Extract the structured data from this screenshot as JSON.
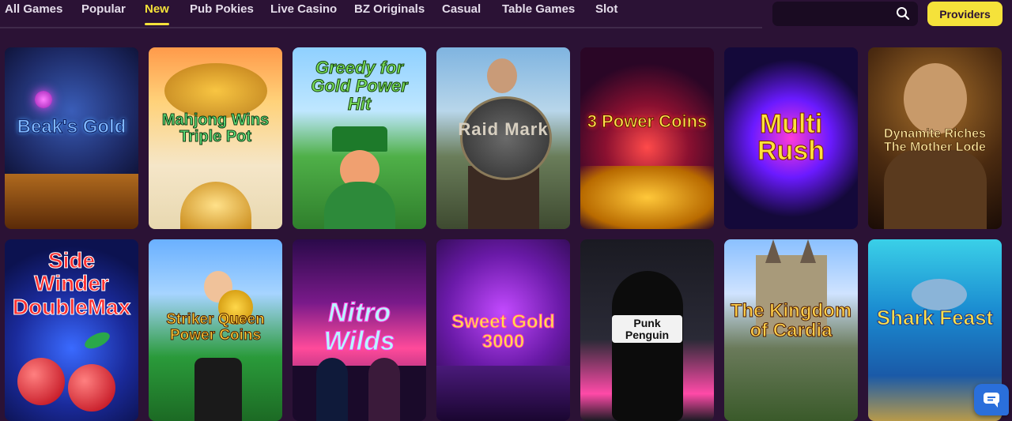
{
  "nav": {
    "tabs": [
      {
        "label": "All Games",
        "active": false
      },
      {
        "label": "Popular",
        "active": false
      },
      {
        "label": "New",
        "active": true
      },
      {
        "label": "Pub Pokies",
        "active": false
      },
      {
        "label": "Live Casino",
        "active": false
      },
      {
        "label": "BZ Originals",
        "active": false
      },
      {
        "label": "Casual",
        "active": false
      },
      {
        "label": "Table Games",
        "active": false
      },
      {
        "label": "Slot",
        "active": false
      }
    ]
  },
  "search": {
    "placeholder": "",
    "icon": "search-icon"
  },
  "providers_button": {
    "label": "Providers"
  },
  "colors": {
    "accent": "#f5e23a",
    "background": "#2b1235",
    "chat": "#2a6fdb"
  },
  "games": [
    {
      "title": "Beak's Gold",
      "icon": "game-tile"
    },
    {
      "title": "Mahjong Wins Triple Pot",
      "icon": "game-tile"
    },
    {
      "title": "Greedy for Gold Power Hit",
      "icon": "game-tile"
    },
    {
      "title": "Raid Mark",
      "icon": "game-tile"
    },
    {
      "title": "3 Power Coins",
      "icon": "game-tile"
    },
    {
      "title": "Multi Rush",
      "icon": "game-tile"
    },
    {
      "title": "Dynamite Riches The Mother Lode",
      "icon": "game-tile"
    },
    {
      "title": "Side Winder DoubleMax",
      "icon": "game-tile"
    },
    {
      "title": "Striker Queen Power Coins",
      "icon": "game-tile"
    },
    {
      "title": "Nitro Wilds",
      "icon": "game-tile"
    },
    {
      "title": "Sweet Gold 3000",
      "icon": "game-tile"
    },
    {
      "title": "Punk Penguin",
      "icon": "game-tile"
    },
    {
      "title": "The Kingdom of Cardia",
      "icon": "game-tile"
    },
    {
      "title": "Shark Feast",
      "icon": "game-tile"
    }
  ],
  "chat_button": {
    "icon": "chat-icon"
  }
}
